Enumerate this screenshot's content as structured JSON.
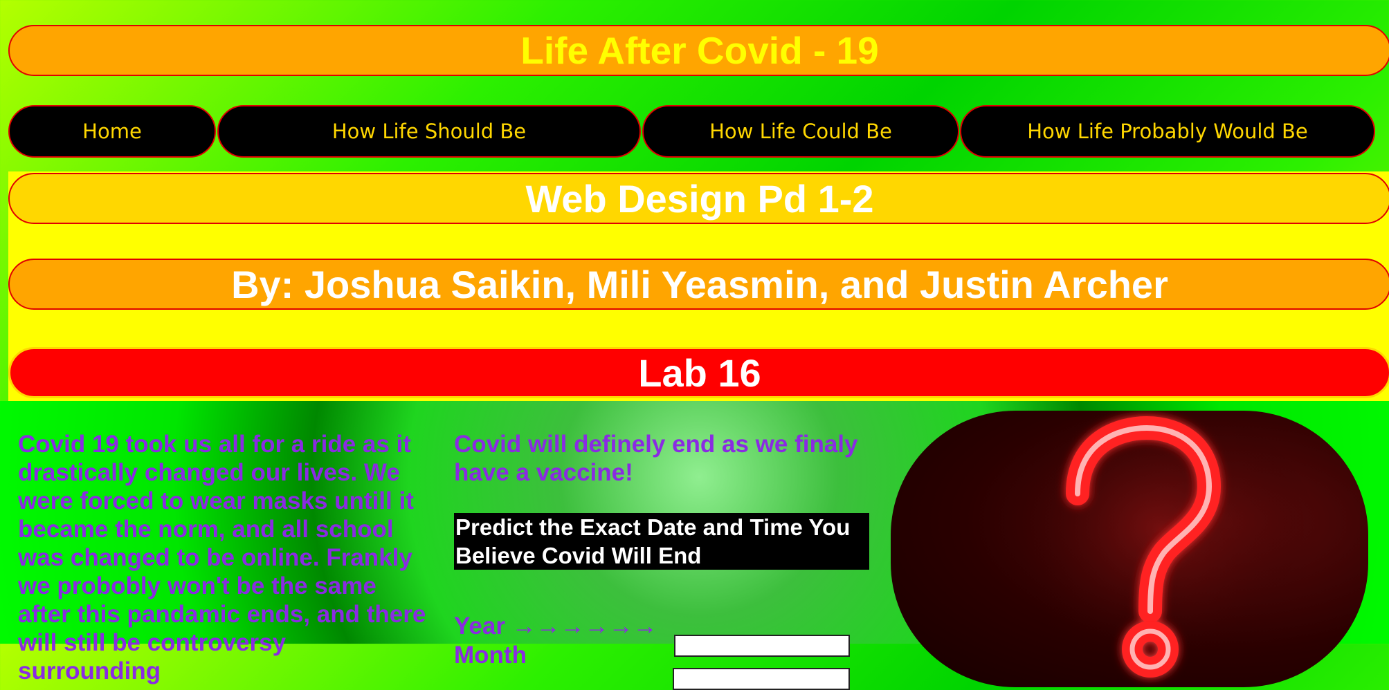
{
  "header": {
    "title": "Life After Covid - 19"
  },
  "nav": {
    "items": [
      {
        "label": "Home"
      },
      {
        "label": "How Life Should Be"
      },
      {
        "label": "How Life Could Be"
      },
      {
        "label": "How Life Probably Would Be"
      }
    ]
  },
  "banner": {
    "course": "Web Design Pd 1-2",
    "authors": "By: Joshua Saikin, Mili Yeasmin, and Justin Archer",
    "lab": "Lab 16"
  },
  "content": {
    "paragraph": "Covid 19 took us all for a ride as it drastically changed our lives. We were forced to wear masks untill it became the norm, and all school was changed to be online. Frankly we probobly won't be the same after this pandamic ends, and there will still be controversy surrounding",
    "vaccine_note": "Covid will definely end as we finaly have a vaccine!",
    "predict_heading": "Predict the Exact Date and Time You Believe Covid Will End",
    "fields": [
      {
        "label": "Year →→→→→→",
        "value": ""
      },
      {
        "label": "Month",
        "value": ""
      }
    ],
    "image": {
      "icon": "neon-question-mark-icon",
      "colors": {
        "neon": "#ff2a2a",
        "glow": "#ff8080",
        "background": "#2a0000"
      }
    }
  },
  "colors": {
    "page_gradient": "#2cf000",
    "title_bar": "#ffa500",
    "title_text": "#ffff00",
    "nav_bg": "#000000",
    "nav_text": "#ffd700",
    "panel": "#ffff00",
    "lab_pill": "#ff0000",
    "body_text": "#8a2be2",
    "border": "#e00000"
  }
}
